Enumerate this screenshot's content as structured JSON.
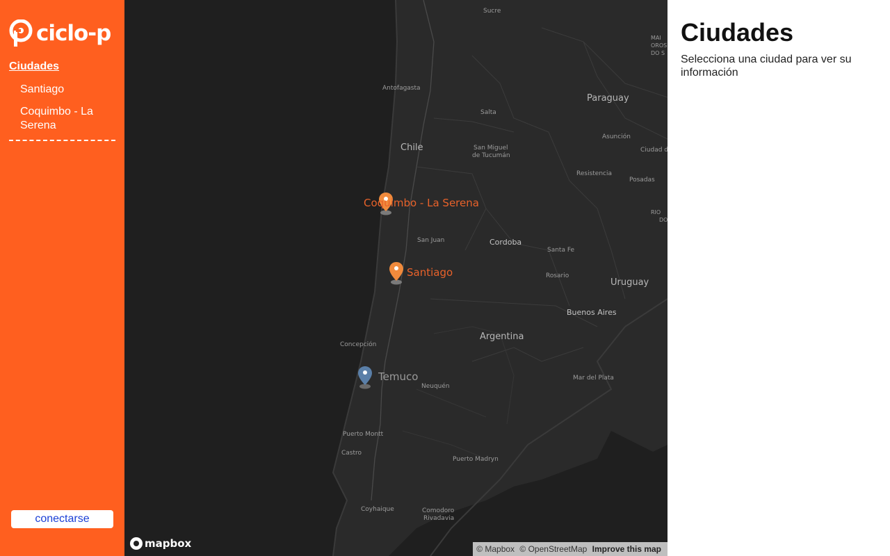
{
  "sidebar": {
    "logo_text": "ciclo-p",
    "nav_title": "Ciudades",
    "items": [
      {
        "label": "Santiago"
      },
      {
        "label": "Coquimbo - La Serena"
      }
    ],
    "connect_label": "conectarse"
  },
  "map": {
    "markers": [
      {
        "label": "Coquimbo - La Serena",
        "color": "#F08A3C",
        "label_color": "#E8622A"
      },
      {
        "label": "Santiago",
        "color": "#F08A3C",
        "label_color": "#E8622A"
      },
      {
        "label": "Temuco",
        "color": "#5A7FA8",
        "label_color": "#9a9a9a"
      }
    ],
    "labels": {
      "sucre": "Sucre",
      "antofagasta": "Antofagasta",
      "salta": "Salta",
      "paraguay": "Paraguay",
      "asuncion": "Asunción",
      "ciudad": "Ciudad d",
      "chile": "Chile",
      "tucuman_1": "San Miguel",
      "tucuman_2": "de Tucumán",
      "resistencia": "Resistencia",
      "posadas": "Posadas",
      "san_juan": "San Juan",
      "cordoba": "Cordoba",
      "santa_fe": "Santa Fe",
      "rosario": "Rosario",
      "uruguay": "Uruguay",
      "buenos_aires": "Buenos Aires",
      "argentina": "Argentina",
      "concepcion": "Concepción",
      "neuquen": "Neuquén",
      "mar_del_plata": "Mar del Plata",
      "puerto_montt": "Puerto Montt",
      "castro": "Castro",
      "puerto_madryn": "Puerto Madryn",
      "coyhaique": "Coyhaique",
      "comodoro_1": "Comodoro",
      "comodoro_2": "Rivadavia",
      "edge_1": "MAI",
      "edge_2": "OROS",
      "edge_3": "DO S",
      "edge_4": "RIO",
      "edge_5": "DO"
    },
    "logo_text": "mapbox",
    "attribution": {
      "mapbox": "© Mapbox",
      "osm": "© OpenStreetMap",
      "improve": "Improve this map"
    }
  },
  "panel": {
    "title": "Ciudades",
    "description": "Selecciona una ciudad para ver su información"
  },
  "colors": {
    "brand": "#FF5F1F",
    "map_background": "#1f1f1f",
    "link": "#1a3fd6"
  }
}
